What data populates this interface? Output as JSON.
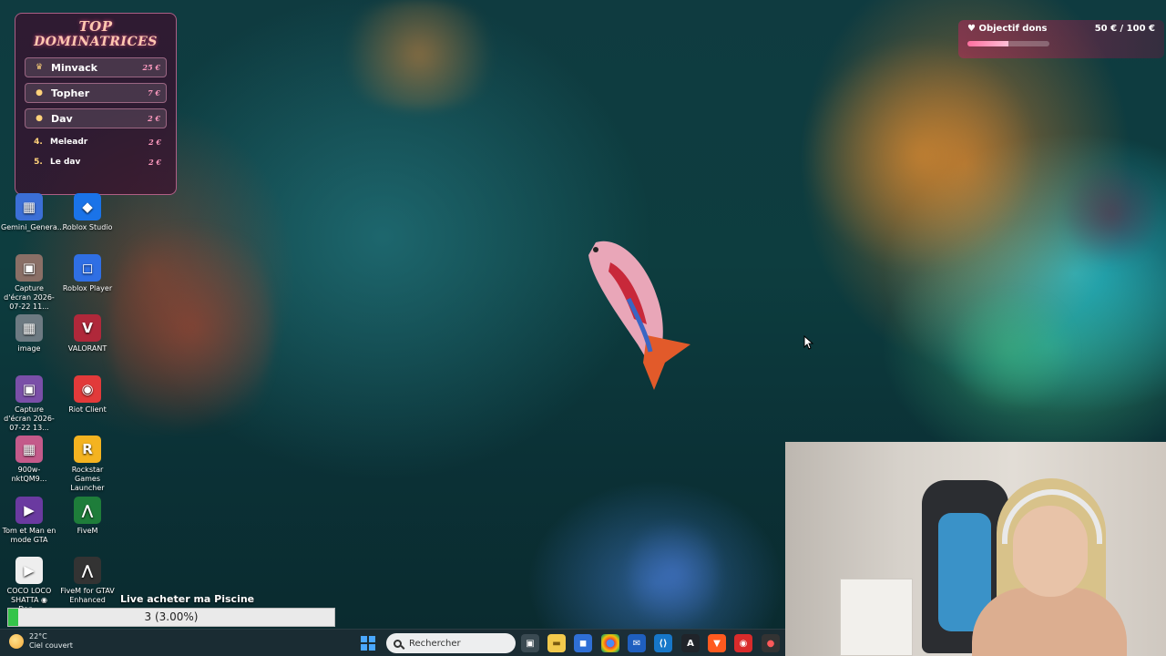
{
  "leaderboard": {
    "title_line1": "TOP",
    "title_line2": "DOMINATRICES",
    "entries": [
      {
        "rank": "1.",
        "name": "Minvack",
        "amount": "25 €"
      },
      {
        "rank": "2.",
        "name": "Topher",
        "amount": "7 €"
      },
      {
        "rank": "3.",
        "name": "Dav",
        "amount": "2 €"
      },
      {
        "rank": "4.",
        "name": "Meleadr",
        "amount": "2 €"
      },
      {
        "rank": "5.",
        "name": "Le dav",
        "amount": "2 €"
      }
    ]
  },
  "donation_goal": {
    "label": "Objectif dons",
    "amount": "50 € / 100 €",
    "progress": 0.5
  },
  "desktop_icons": [
    {
      "label": "Gemini_Genera...",
      "icon": "image-icon",
      "color": "#3b6fd6"
    },
    {
      "label": "Roblox Studio",
      "icon": "roblox-studio-icon",
      "color": "#1a73e8"
    },
    {
      "label": "Capture d'écran 2026-07-22 11...",
      "icon": "screenshot-icon",
      "color": "#8a6f66"
    },
    {
      "label": "Roblox Player",
      "icon": "roblox-player-icon",
      "color": "#2f6fe4"
    },
    {
      "label": "image",
      "icon": "image-icon",
      "color": "#6d7a82"
    },
    {
      "label": "VALORANT",
      "icon": "valorant-icon",
      "color": "#b0283a"
    },
    {
      "label": "Capture d'écran 2026-07-22 13...",
      "icon": "screenshot-icon",
      "color": "#7a4fa8"
    },
    {
      "label": "Riot Client",
      "icon": "riot-client-icon",
      "color": "#e23a3a"
    },
    {
      "label": "900w-nktQM9...",
      "icon": "image-icon",
      "color": "#c45a8a"
    },
    {
      "label": "Rockstar Games Launcher",
      "icon": "rockstar-icon",
      "color": "#f4b320"
    },
    {
      "label": "Tom et Man en mode GTA",
      "icon": "video-icon",
      "color": "#6a3aa0"
    },
    {
      "label": "FiveM",
      "icon": "fivem-icon",
      "color": "#1e7d3a"
    },
    {
      "label": "COCO LOCO SHATTA ◉ Dan...",
      "icon": "video-icon",
      "color": "#eeeeee"
    },
    {
      "label": "FiveM for GTAV Enhanced",
      "icon": "fivem-icon",
      "color": "#333333"
    }
  ],
  "live_progress": {
    "label": "Live acheter ma Piscine",
    "value_text": "3 (3.00%)",
    "fraction": 0.03
  },
  "taskbar": {
    "temperature": "22°C",
    "weather_desc": "Ciel couvert",
    "search_placeholder": "Rechercher"
  }
}
